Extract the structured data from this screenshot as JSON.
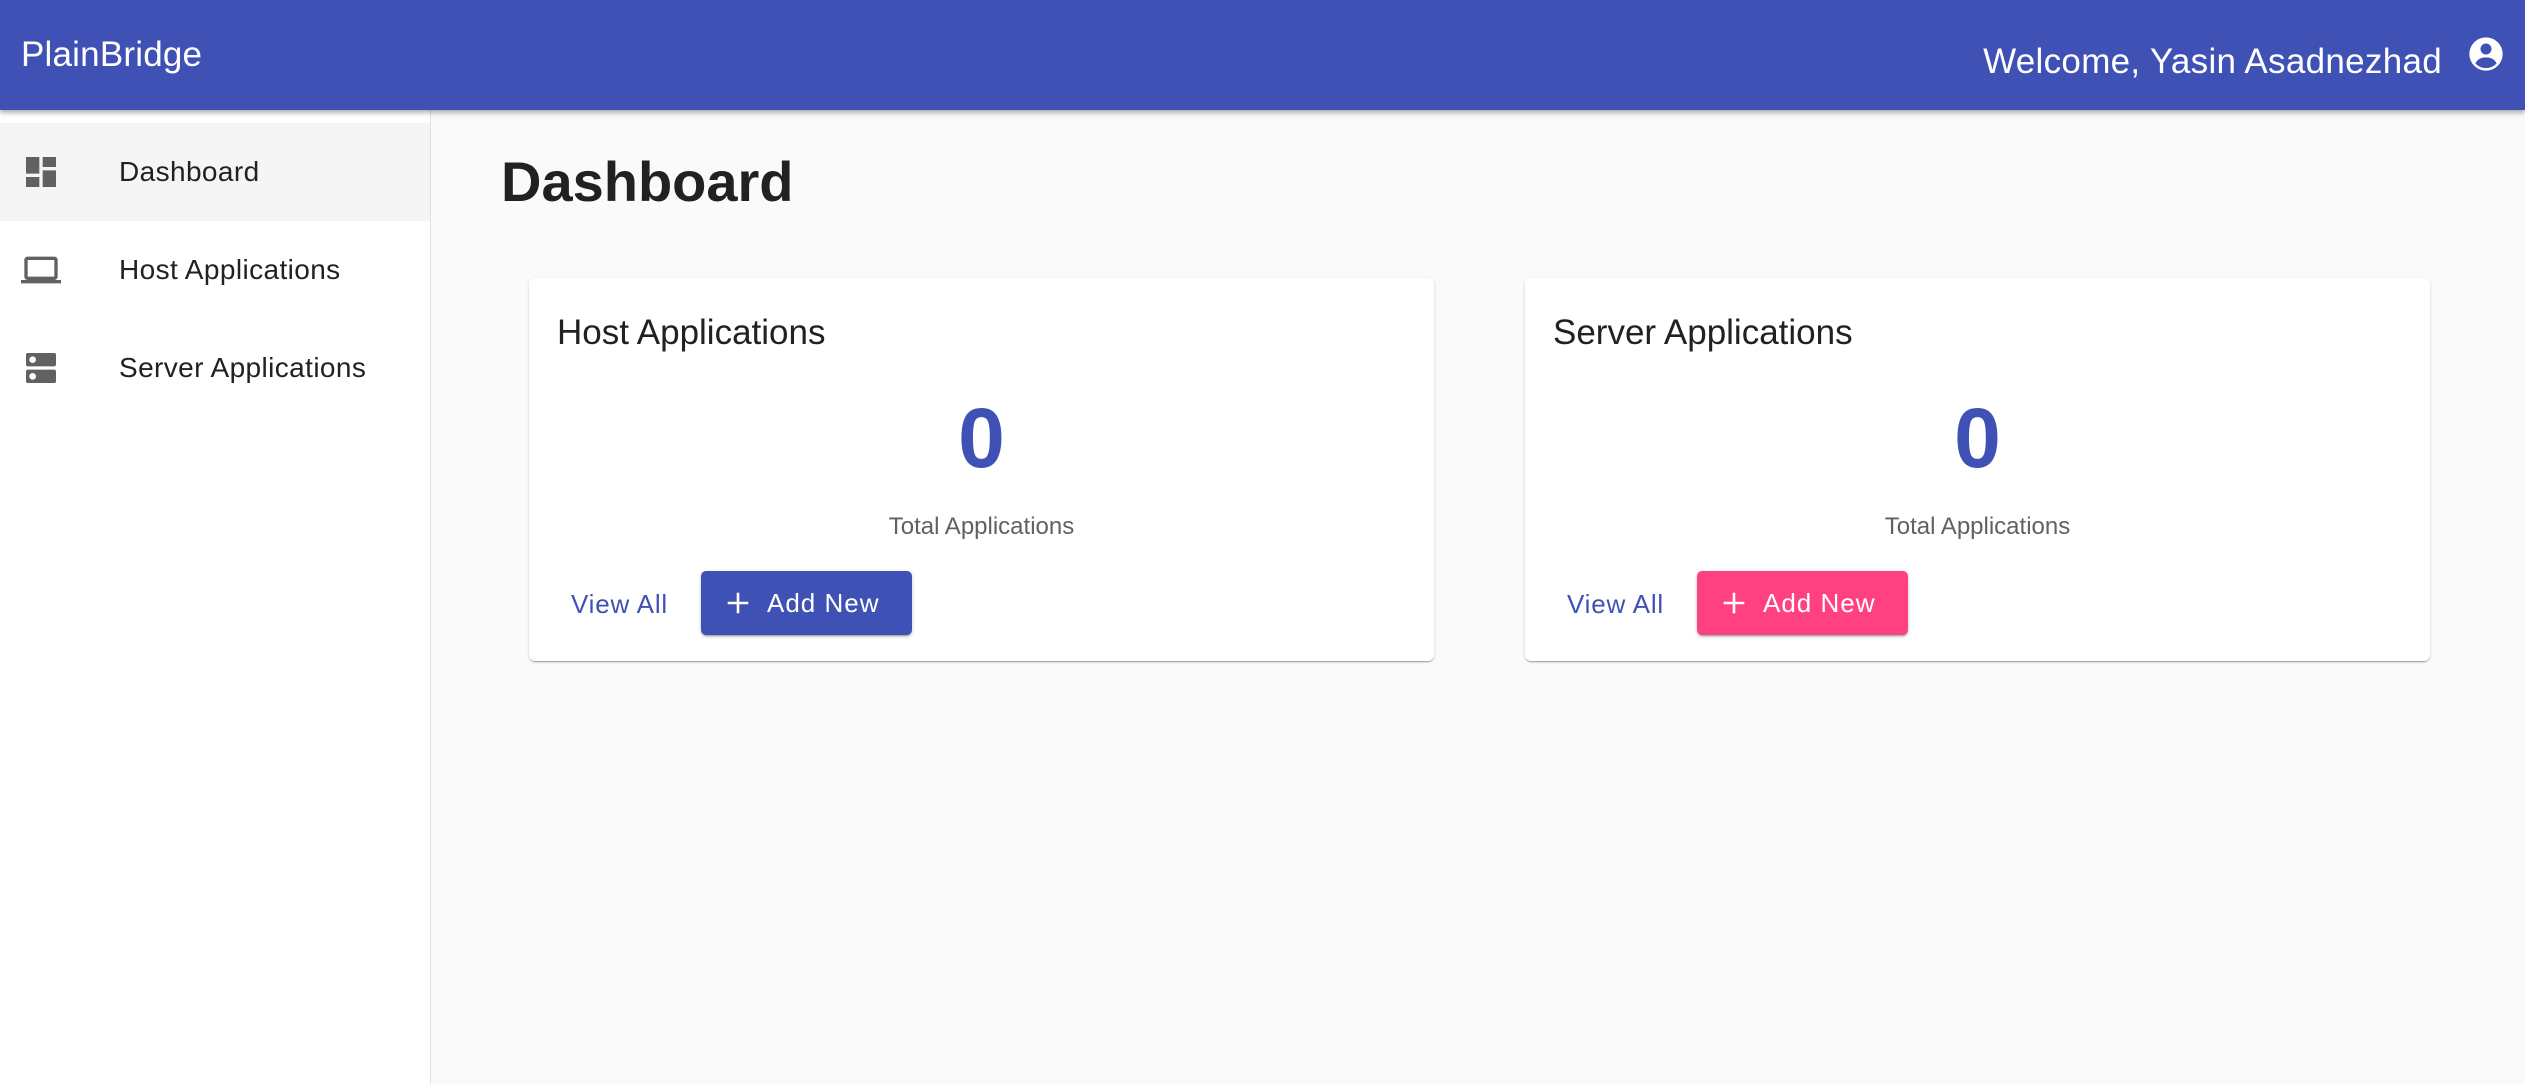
{
  "app": {
    "brand": "PlainBridge",
    "welcome": "Welcome, Yasin Asadnezhad",
    "primary_color": "#3f51b5",
    "accent_color": "#ff4081"
  },
  "sidebar": {
    "items": [
      {
        "label": "Dashboard",
        "icon": "dashboard-icon",
        "active": true
      },
      {
        "label": "Host Applications",
        "icon": "laptop-icon",
        "active": false
      },
      {
        "label": "Server Applications",
        "icon": "server-icon",
        "active": false
      }
    ]
  },
  "main": {
    "title": "Dashboard",
    "cards": [
      {
        "title": "Host Applications",
        "count": "0",
        "caption": "Total Applications",
        "view_label": "View All",
        "add_label": "Add New",
        "add_color": "#3f51b5"
      },
      {
        "title": "Server Applications",
        "count": "0",
        "caption": "Total Applications",
        "view_label": "View All",
        "add_label": "Add New",
        "add_color": "#ff4081"
      }
    ]
  }
}
